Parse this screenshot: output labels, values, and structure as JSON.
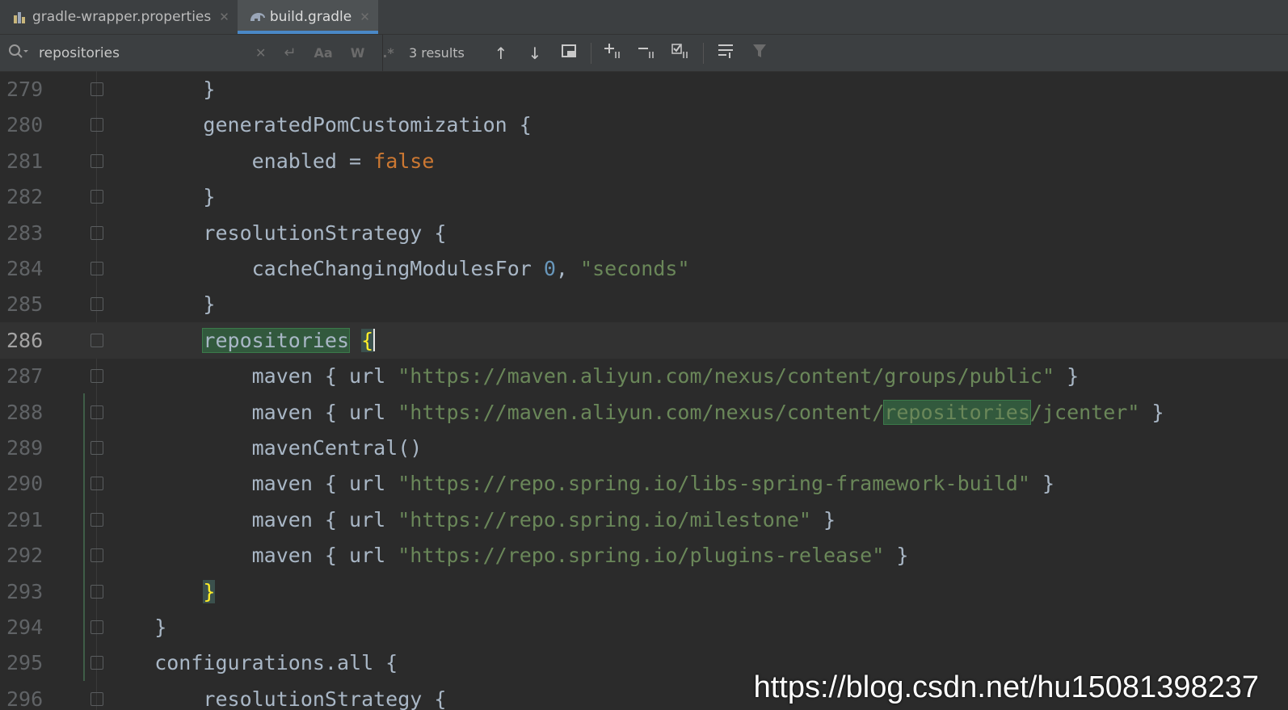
{
  "tabs": [
    {
      "label": "gradle-wrapper.properties",
      "icon": "properties-file-icon",
      "active": false
    },
    {
      "label": "build.gradle",
      "icon": "gradle-elephant-icon",
      "active": true
    }
  ],
  "search": {
    "query": "repositories",
    "results": "3 results",
    "case_label": "Aa",
    "words_label": "W",
    "regex_label": ".*"
  },
  "editor": {
    "lines": [
      {
        "n": "279",
        "html": "        }"
      },
      {
        "n": "280",
        "html": "        generatedPomCustomization {"
      },
      {
        "n": "281",
        "html": "            enabled = <span class=\"kw\">false</span>"
      },
      {
        "n": "282",
        "html": "        }"
      },
      {
        "n": "283",
        "html": "        resolutionStrategy {"
      },
      {
        "n": "284",
        "html": "            cacheChangingModulesFor <span class=\"num\">0</span>, <span class=\"str\">\"seconds\"</span>"
      },
      {
        "n": "285",
        "html": "        }"
      },
      {
        "n": "286",
        "html": "        <span class=\"hl\">repositories</span> <span class=\"brace\">{</span><span class=\"caret\"></span>",
        "current": true
      },
      {
        "n": "287",
        "html": "            maven { url <span class=\"str\">\"https://maven.aliyun.com/nexus/content/groups/public\"</span> }"
      },
      {
        "n": "288",
        "html": "            maven { url <span class=\"str\">\"https://maven.aliyun.com/nexus/content/<span class=\"hl\">repositories</span>/jcenter\"</span> }"
      },
      {
        "n": "289",
        "html": "            mavenCentral()"
      },
      {
        "n": "290",
        "html": "            maven { url <span class=\"str\">\"https://repo.spring.io/libs-spring-framework-build\"</span> }"
      },
      {
        "n": "291",
        "html": "            maven { url <span class=\"str\">\"https://repo.spring.io/milestone\"</span> }"
      },
      {
        "n": "292",
        "html": "            maven { url <span class=\"str\">\"https://repo.spring.io/plugins-release\"</span> }"
      },
      {
        "n": "293",
        "html": "        <span class=\"brace\">}</span>"
      },
      {
        "n": "294",
        "html": "    }"
      },
      {
        "n": "295",
        "html": "    configurations.all {"
      },
      {
        "n": "296",
        "html": "        resolutionStrategy {"
      }
    ]
  },
  "watermark": "https://blog.csdn.net/hu15081398237"
}
